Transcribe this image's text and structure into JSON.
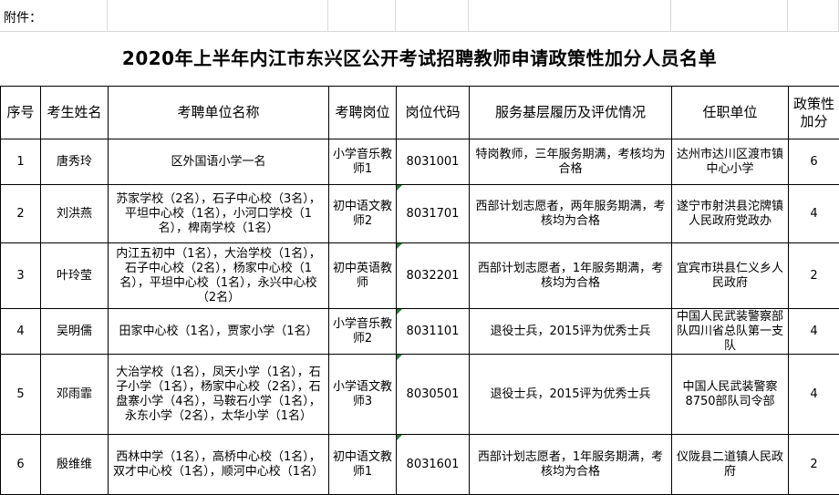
{
  "attachment_label": "附件：",
  "title": "2020年上半年内江市东兴区公开考试招聘教师申请政策性加分人员名单",
  "headers": [
    "序号",
    "考生姓名",
    "考聘单位名称",
    "考聘岗位",
    "岗位代码",
    "服务基层履历及评优情况",
    "任职单位",
    "政策性加分"
  ],
  "rows": [
    {
      "no": "1",
      "name": "唐秀玲",
      "unit": "区外国语小学一名",
      "post": "小学音乐教师1",
      "code": "8031001",
      "history": "特岗教师，三年服务期满，考核均为合格",
      "employer": "达州市达川区渡市镇中心小学",
      "points": "6"
    },
    {
      "no": "2",
      "name": "刘洪燕",
      "unit": "苏家学校（2名），石子中心校（3名），平坦中心校（1名），小河口学校（1名），椑南学校（1名）",
      "post": "初中语文教师2",
      "code": "8031701",
      "history": "西部计划志愿者，两年服务期满，考核均为合格",
      "employer": "遂宁市射洪县沱牌镇人民政府党政办",
      "points": "4"
    },
    {
      "no": "3",
      "name": "叶玲莹",
      "unit": "内江五初中（1名），大治学校（1名），石子中心校（2名），杨家中心校（1名），平坦中心校（1名），永兴中心校（2名）",
      "post": "初中英语教师",
      "code": "8032201",
      "history": "西部计划志愿者，1年服务期满，考核均为合格",
      "employer": "宜宾市珙县仁义乡人民政府",
      "points": "2"
    },
    {
      "no": "4",
      "name": "吴明儒",
      "unit": "田家中心校（1名），贾家小学（1名）",
      "post": "小学音乐教师2",
      "code": "8031101",
      "history": "退役士兵，2015评为优秀士兵",
      "employer": "中国人民武装警察部队四川省总队第一支队",
      "points": "4"
    },
    {
      "no": "5",
      "name": "邓雨霏",
      "unit": "大治学校（1名），凤天小学（1名），石子小学（1名），杨家中心校（2名），石盘寨小学（4名），马鞍石小学（1名），永东小学（2名），太华小学（1名）",
      "post": "小学语文教师3",
      "code": "8030501",
      "history": "退役士兵，2015评为优秀士兵",
      "employer": "中国人民武装警察8750部队司令部",
      "points": "4"
    },
    {
      "no": "6",
      "name": "殷维维",
      "unit": "西林中学（1名），高桥中心校（1名），双才中心校（1名），顺河中心校（1名）",
      "post": "初中语文教师1",
      "code": "8031601",
      "history": "西部计划志愿者，1年服务期满，考核均为合格",
      "employer": "仪陇县二道镇人民政府",
      "points": "2"
    }
  ]
}
